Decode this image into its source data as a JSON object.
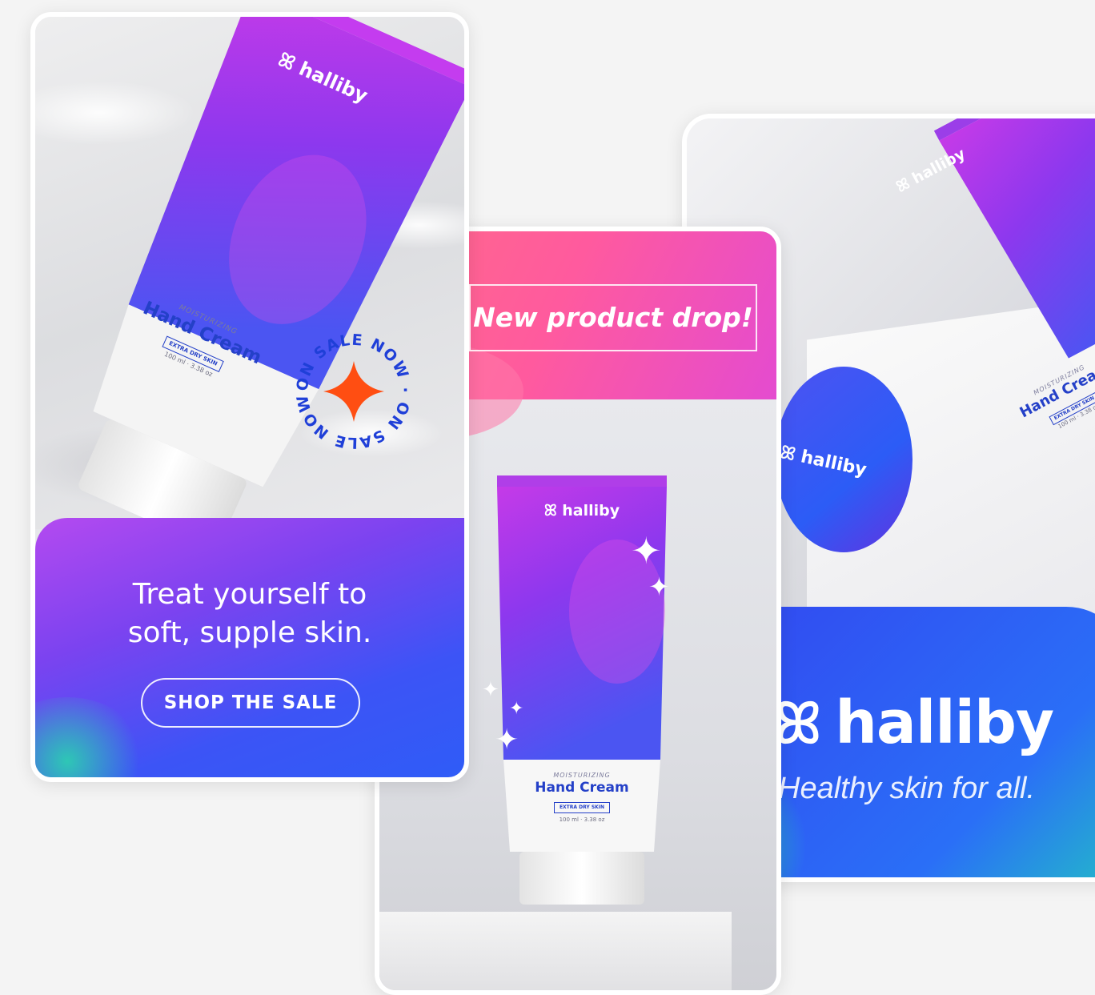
{
  "brand": {
    "name": "halliby",
    "logo_icon": "halliby-butterfly-icon"
  },
  "product": {
    "descriptor": "MOISTURIZING",
    "name": "Hand Cream",
    "variant": "EXTRA DRY SKIN",
    "size": "100 ml · 3.38 oz"
  },
  "card_sale": {
    "badge_text": "ON SALE NOW · ON SALE NOW ·",
    "headline_line1": "Treat yourself to",
    "headline_line2": "soft, supple skin.",
    "cta_label": "SHOP THE SALE"
  },
  "card_drop": {
    "headline": "New product drop!"
  },
  "card_brand": {
    "brand_text": "halliby",
    "tagline": "Healthy skin for all."
  },
  "colors": {
    "page_bg": "#f4f4f4",
    "purple": "#8a3cf2",
    "blue": "#2f5cf7",
    "pink": "#ff5a9e",
    "badge_orange": "#ff4e12",
    "badge_text": "#1f3fd8",
    "teal": "#22d4b3"
  }
}
